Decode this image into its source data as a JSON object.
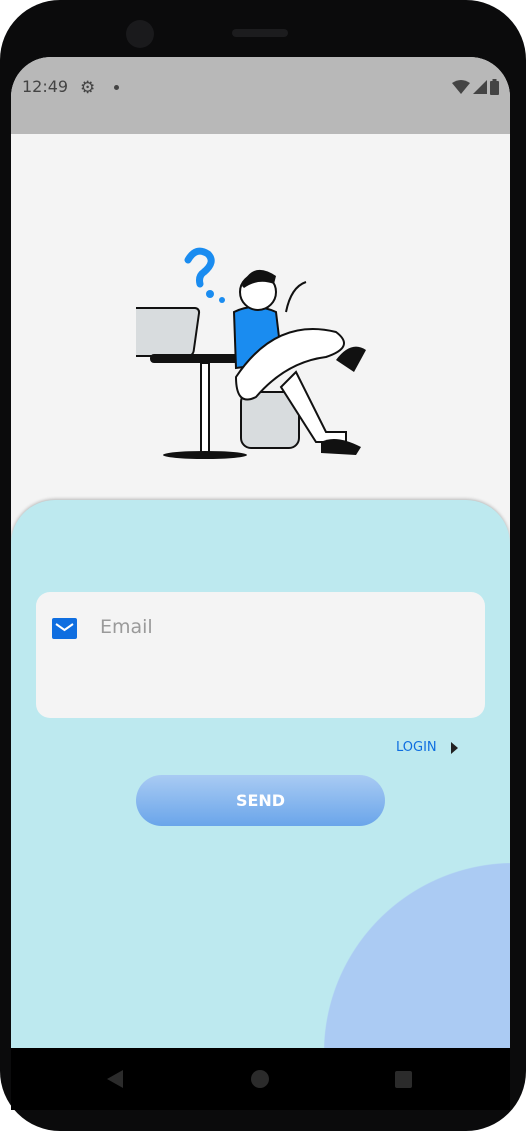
{
  "status_bar": {
    "time": "12:49",
    "icons": [
      "gear-icon",
      "notification-dot-icon",
      "wifi-icon",
      "signal-icon",
      "battery-icon"
    ]
  },
  "form": {
    "email_placeholder": "Email",
    "email_value": "",
    "login_label": "LOGIN",
    "send_label": "SEND"
  },
  "colors": {
    "accent": "#0f6ee0",
    "card": "#bde9ef",
    "circle": "#abcbf3",
    "button_top": "#a9cbf3",
    "button_bottom": "#6aa5ea"
  },
  "nav": {
    "icons": [
      "back-icon",
      "home-icon",
      "recents-icon"
    ]
  }
}
